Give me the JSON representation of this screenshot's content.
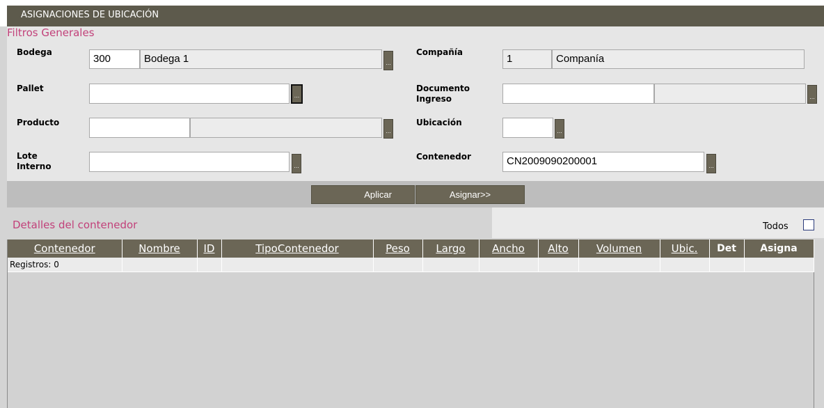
{
  "window": {
    "title": "ASIGNACIONES DE UBICACIÓN"
  },
  "filters": {
    "section_title": "Filtros Generales",
    "bodega": {
      "label": "Bodega",
      "code": "300",
      "name": "Bodega 1"
    },
    "compania": {
      "label": "Compañía",
      "code": "1",
      "name": "Companía"
    },
    "pallet": {
      "label": "Pallet",
      "value": ""
    },
    "documento": {
      "label_line1": "Documento",
      "label_line2": "Ingreso",
      "code": "",
      "name": ""
    },
    "producto": {
      "label": "Producto",
      "code": "",
      "name": ""
    },
    "ubicacion": {
      "label": "Ubicación",
      "value": ""
    },
    "lote": {
      "label_line1": "Lote",
      "label_line2": "Interno",
      "value": ""
    },
    "contenedor": {
      "label": "Contenedor",
      "value": "CN2009090200001"
    },
    "lookup_glyph": "..."
  },
  "actions": {
    "aplicar": "Aplicar",
    "asignar": "Asignar>>"
  },
  "details": {
    "section_title": "Detalles del contenedor",
    "todos_label": "Todos",
    "todos_checked": false
  },
  "grid": {
    "columns": [
      "Contenedor",
      "Nombre",
      "ID",
      "TipoContenedor",
      "Peso",
      "Largo",
      "Ancho",
      "Alto",
      "Volumen",
      "Ubic.",
      "Det",
      "Asigna"
    ],
    "records_label": "Registros: 0"
  },
  "colors": {
    "header": "#5d5a4c",
    "button": "#6b6656",
    "section_title": "#c2417a"
  }
}
